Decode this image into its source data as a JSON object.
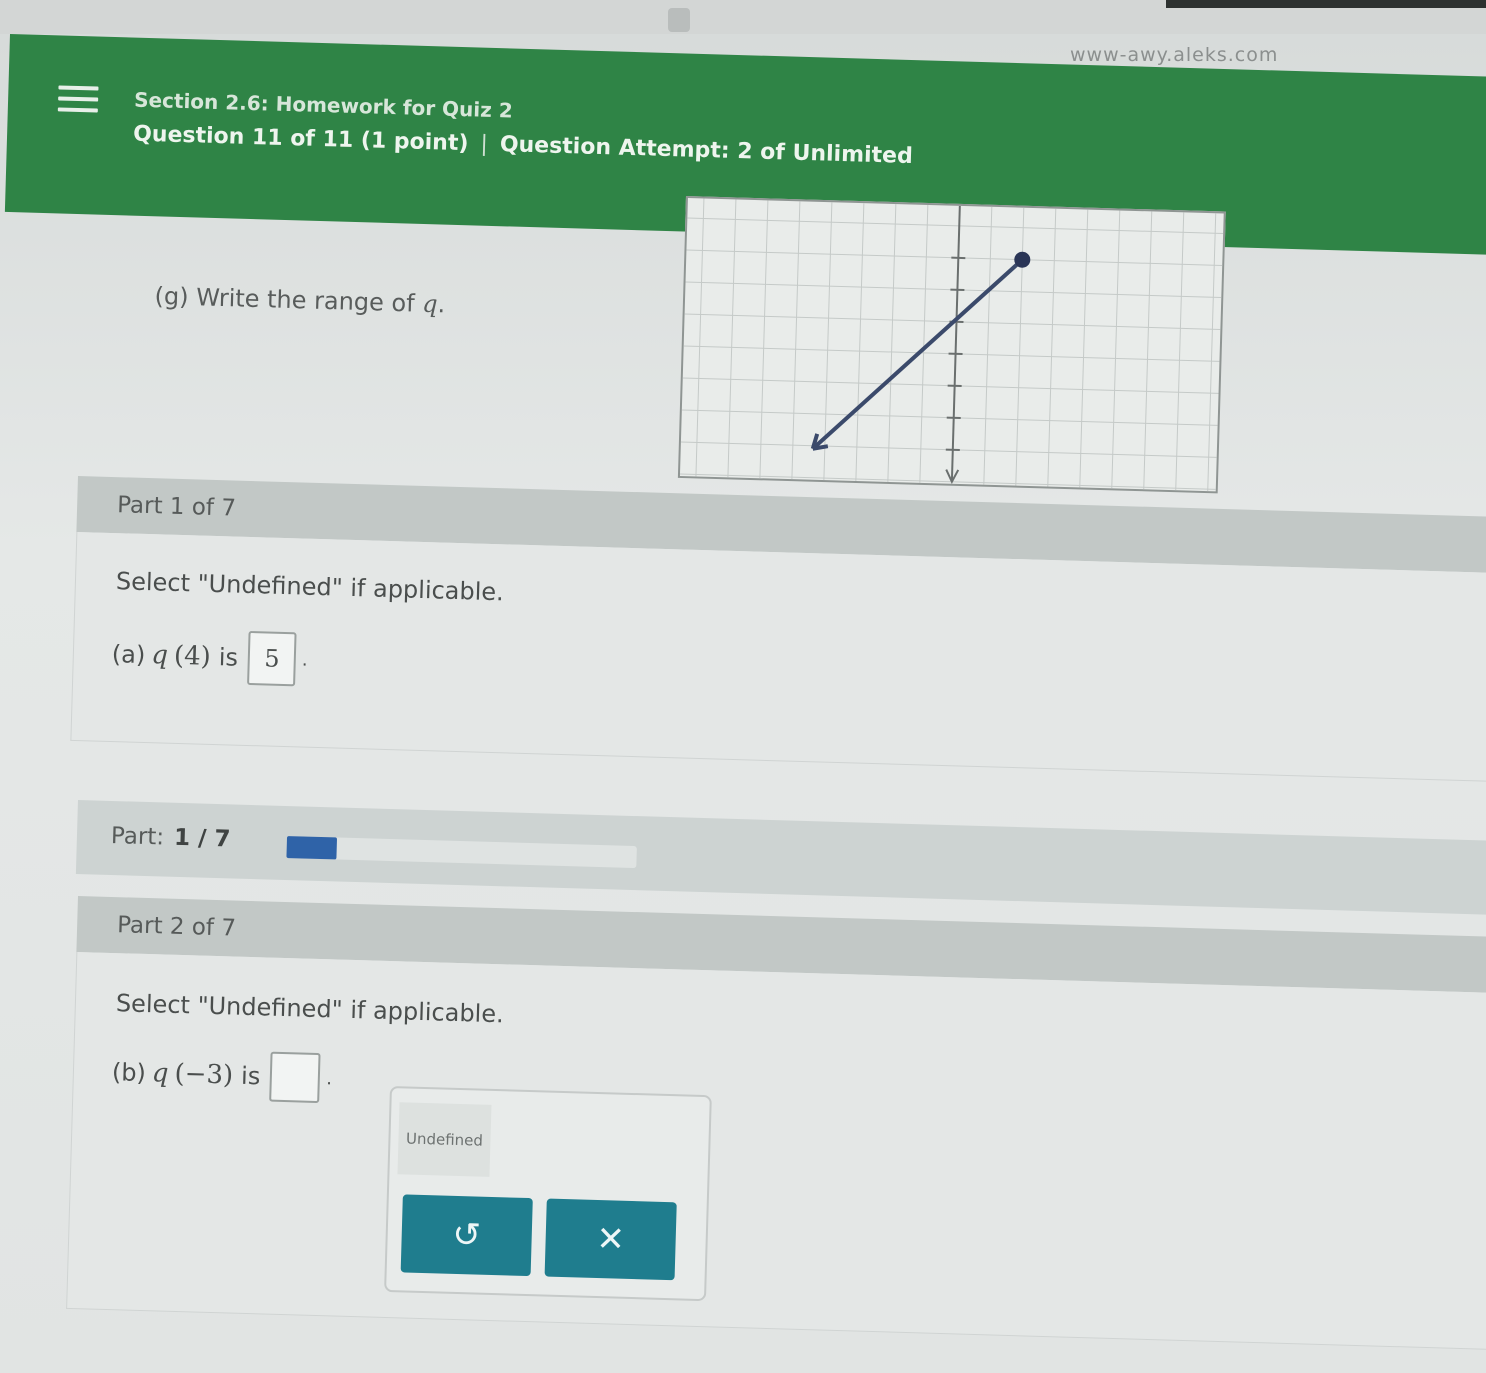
{
  "browser": {
    "url": "www-awy.aleks.com"
  },
  "header": {
    "section_title": "Section 2.6: Homework for Quiz 2",
    "question_info": "Question 11 of 11 (1 point)",
    "separator": "|",
    "attempt_info": "Question Attempt: 2 of Unlimited"
  },
  "question": {
    "part_g_prompt_prefix": "(g) Write the range of ",
    "part_g_var": "q",
    "part_g_suffix": "."
  },
  "graph": {
    "description": "line segment with closed endpoint at upper right and arrow at lower left",
    "colors": {
      "line": "#3b4a6b",
      "dot": "#2a3556",
      "grid": "#c5cac8",
      "axis": "#6a6f6e"
    }
  },
  "part1": {
    "heading": "Part 1 of 7",
    "instruction": "Select \"Undefined\" if applicable.",
    "label": "(a)",
    "func": "q",
    "arg": "4",
    "is_text": "is",
    "answer": "5",
    "period": "."
  },
  "progress": {
    "label": "Part:",
    "value": "1 / 7",
    "fraction": 0.143,
    "color": "#2f63a8"
  },
  "part2": {
    "heading": "Part 2 of 7",
    "instruction": "Select \"Undefined\" if applicable.",
    "label": "(b)",
    "func": "q",
    "arg": "−3",
    "is_text": "is",
    "answer": "",
    "period": "."
  },
  "popup": {
    "undefined_label": "Undefined",
    "undo_icon": "↺",
    "clear_icon": "✕",
    "button_color": "#1f7d8e"
  }
}
